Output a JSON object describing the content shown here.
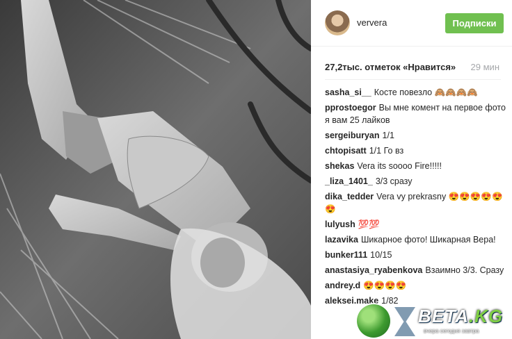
{
  "post": {
    "username": "ververa",
    "follow_label": "Подписки",
    "likes": "27,2тыс. отметок «Нравится»",
    "time": "29 мин",
    "comments": [
      {
        "user": "sasha_si__",
        "text": "Косте повезло 🙈🙈🙈🙈"
      },
      {
        "user": "pprostoegor",
        "text": "Вы мне комент на первое фото я вам 25 лайков"
      },
      {
        "user": "sergeiburyan",
        "text": "1/1"
      },
      {
        "user": "chtopisatt",
        "text": "1/1 Го вз"
      },
      {
        "user": "shekas",
        "text": "Vera its soooo Fire!!!!!"
      },
      {
        "user": "_liza_1401_",
        "text": "3/3 сразу"
      },
      {
        "user": "dika_tedder",
        "text": "Vera vy prekrasny 😍😍😍😍😍😍"
      },
      {
        "user": "lulyush",
        "text": "💯💯"
      },
      {
        "user": "lazavika",
        "text": "Шикарное фото! Шикарная Вера!"
      },
      {
        "user": "bunker111",
        "text": "10/15"
      },
      {
        "user": "anastasiya_ryabenkova",
        "text": "Взаимно 3/3. Сразу"
      },
      {
        "user": "andrey.d",
        "text": "😍😍😍😍"
      },
      {
        "user": "aleksei.make",
        "text": "1/82"
      }
    ]
  },
  "watermark": {
    "logo_text": "BETA",
    "logo_tld": ".KG",
    "tagline": "вчера сегодня завтра"
  },
  "icons": {
    "avatar": "avatar",
    "photo": "post-photo"
  }
}
